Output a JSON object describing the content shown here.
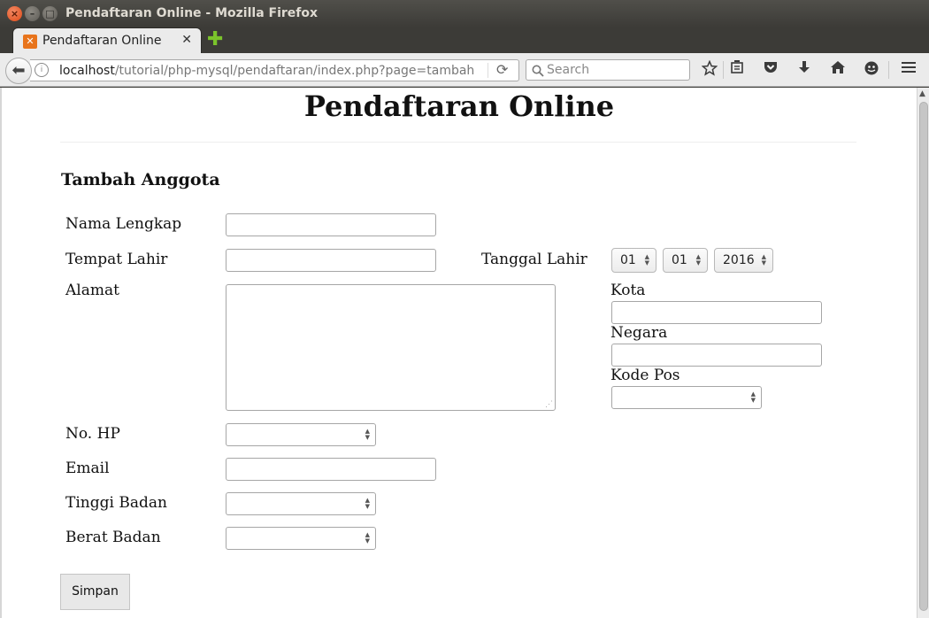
{
  "window": {
    "title": "Pendaftaran Online - Mozilla Firefox",
    "close_symbol": "×",
    "min_symbol": "–",
    "max_symbol": "□"
  },
  "tab": {
    "label": "Pendaftaran Online",
    "favicon_letter": "✕",
    "close_symbol": "✕",
    "new_tab_symbol": "✚"
  },
  "navbar": {
    "back_symbol": "⬅",
    "url_host": "localhost",
    "url_path": "/tutorial/php-mysql/pendaftaran/index.php?page=tambah",
    "reload_symbol": "⟳",
    "search_placeholder": "Search",
    "icons": [
      "star-icon",
      "reading-list-icon",
      "pocket-icon",
      "download-icon",
      "home-icon",
      "social-icon",
      "menu-icon"
    ]
  },
  "page": {
    "title": "Pendaftaran Online",
    "section_title": "Tambah Anggota",
    "labels": {
      "nama": "Nama Lengkap",
      "tempat": "Tempat Lahir",
      "tanggal": "Tanggal Lahir",
      "alamat": "Alamat",
      "kota": "Kota",
      "negara": "Negara",
      "kode_pos": "Kode Pos",
      "hp": "No. HP",
      "email": "Email",
      "tinggi": "Tinggi Badan",
      "berat": "Berat Badan"
    },
    "date_selects": {
      "day": "01",
      "month": "01",
      "year": "2016"
    },
    "submit_label": "Simpan"
  }
}
